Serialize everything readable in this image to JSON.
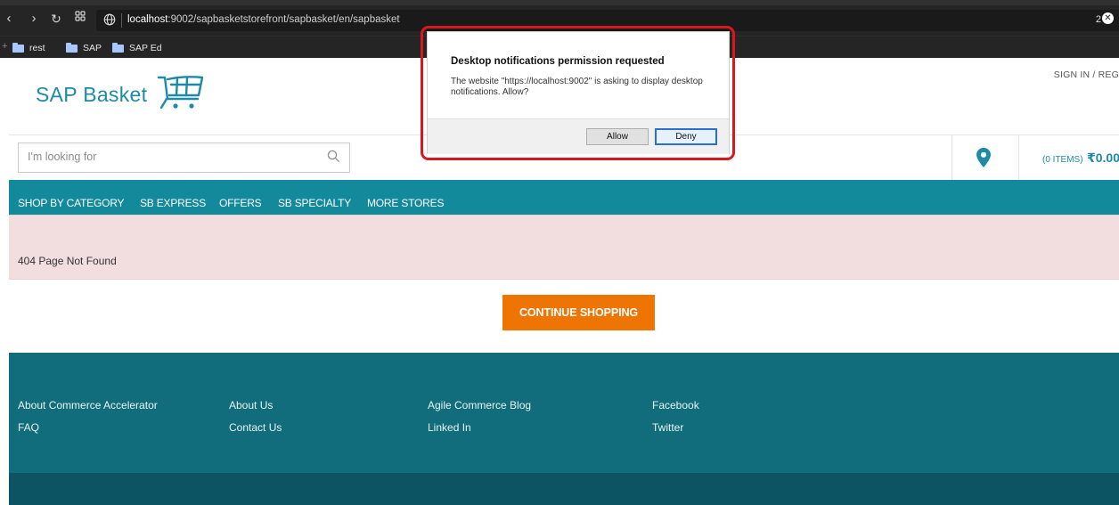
{
  "browser": {
    "url_host": "localhost",
    "url_rest": ":9002/sapbasketstorefront/sapbasket/en/sapbasket",
    "extension_count": "2",
    "bookmarks": [
      {
        "label": "rest"
      },
      {
        "label": "SAP"
      },
      {
        "label": "SAP Ed"
      }
    ]
  },
  "header": {
    "logo_text": "SAP Basket",
    "signin_label": "SIGN IN / REG"
  },
  "search": {
    "placeholder": "I'm looking for"
  },
  "cart": {
    "items_label": "(0 ITEMS)",
    "total": "₹0.00"
  },
  "nav": {
    "items": [
      {
        "label": "SHOP BY CATEGORY"
      },
      {
        "label": "SB EXPRESS"
      },
      {
        "label": "OFFERS"
      },
      {
        "label": "SB SPECIALTY"
      },
      {
        "label": "MORE STORES"
      }
    ]
  },
  "alert": {
    "message": "404 Page Not Found"
  },
  "continue_label": "CONTINUE SHOPPING",
  "footer": {
    "links": [
      {
        "label": "About Commerce Accelerator"
      },
      {
        "label": "FAQ"
      },
      {
        "label": "About Us"
      },
      {
        "label": "Contact Us"
      },
      {
        "label": "Agile Commerce Blog"
      },
      {
        "label": "Linked In"
      },
      {
        "label": "Facebook"
      },
      {
        "label": "Twitter"
      }
    ]
  },
  "dialog": {
    "title": "Desktop notifications permission requested",
    "message": "The website \"https://localhost:9002\" is asking to display desktop notifications. Allow?",
    "allow_label": "Allow",
    "deny_label": "Deny"
  },
  "colors": {
    "brand_teal": "#13899c",
    "footer_teal": "#116c7b",
    "accent_orange": "#ee7503",
    "highlight_red": "#d9171e"
  }
}
